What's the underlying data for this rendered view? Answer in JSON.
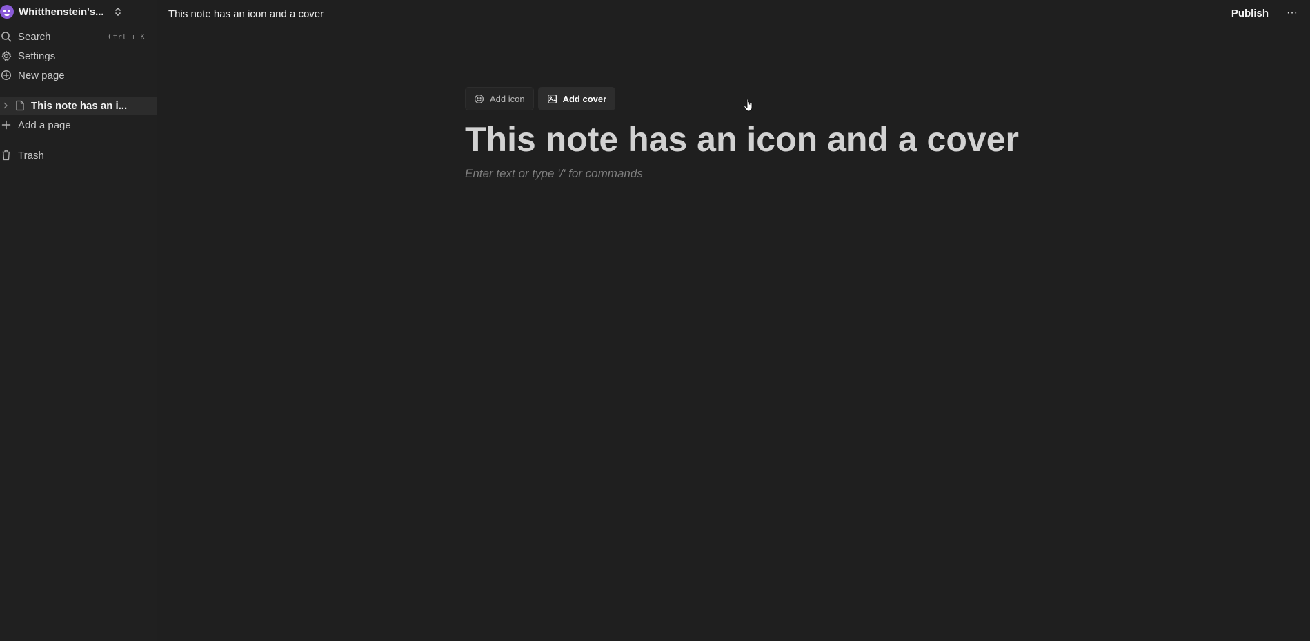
{
  "workspace": {
    "name": "Whitthenstein's...",
    "avatar_color": "#8a5bd8"
  },
  "sidebar": {
    "search": {
      "label": "Search",
      "shortcut": "Ctrl + K",
      "icon": "search-icon"
    },
    "settings": {
      "label": "Settings",
      "icon": "gear-icon"
    },
    "new_page": {
      "label": "New page",
      "icon": "plus-circle-icon"
    },
    "pages": [
      {
        "label": "This note has an i...",
        "icon": "document-icon",
        "selected": true
      }
    ],
    "add_page": {
      "label": "Add a page",
      "icon": "plus-icon"
    },
    "trash": {
      "label": "Trash",
      "icon": "trash-icon"
    }
  },
  "topbar": {
    "title": "This note has an icon and a cover",
    "publish_label": "Publish",
    "more_label": "···"
  },
  "editor": {
    "add_icon_label": "Add icon",
    "add_cover_label": "Add cover",
    "title": "This note has an icon and a cover",
    "placeholder": "Enter text or type '/' for commands"
  }
}
